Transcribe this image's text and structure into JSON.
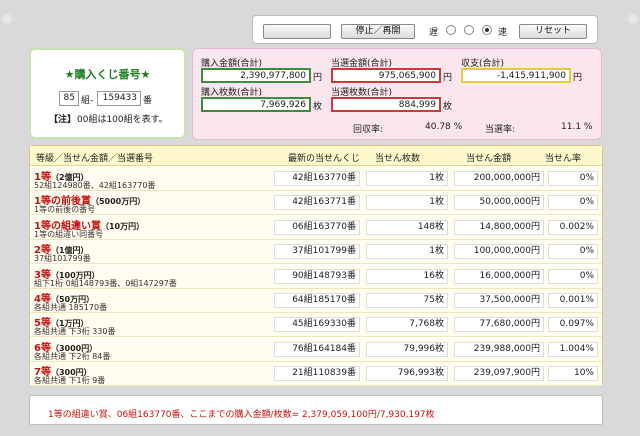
{
  "controls": {
    "blank_button": "",
    "stop_resume": "停止／再開",
    "speed_slow": "遅",
    "speed_fast": "速",
    "reset": "リセット"
  },
  "lot": {
    "title": "★購入くじ番号★",
    "group": "85",
    "group_suffix": "組-",
    "number": "159433",
    "number_suffix": "番",
    "note_tag": "【注】",
    "note_text": "00組は100組を表す。"
  },
  "summary": {
    "purchase_amount_label": "購入金額(合計)",
    "purchase_amount": "2,390,977,800",
    "purchase_count_label": "購入枚数(合計)",
    "purchase_count": "7,969,926",
    "win_amount_label": "当選金額(合計)",
    "win_amount": "975,065,900",
    "win_count_label": "当選枚数(合計)",
    "win_count": "884,999",
    "balance_label": "収支(合計)",
    "balance": "-1,415,911,900",
    "yen": "円",
    "mai": "枚",
    "recovery_label": "回収率:",
    "recovery": "40.78 %",
    "win_rate_label": "当選率:",
    "win_rate": "11.1 %"
  },
  "table": {
    "headers": [
      "等級／当せん金額／当選番号",
      "最新の当せんくじ",
      "当せん枚数",
      "当せん金額",
      "当せん率"
    ],
    "rows": [
      {
        "rank": "1等",
        "amount": "（2億円）",
        "sub": "52組124980番、42組163770番",
        "latest": "42組163770番",
        "count": "1枚",
        "money": "200,000,000円",
        "rate": "0%"
      },
      {
        "rank": "1等の前後賞",
        "amount": "（5000万円）",
        "sub": "1等の前後の番号",
        "latest": "42組163771番",
        "count": "1枚",
        "money": "50,000,000円",
        "rate": "0%"
      },
      {
        "rank": "1等の組違い賞",
        "amount": "（10万円）",
        "sub": "1等の組違い同番号",
        "latest": "06組163770番",
        "count": "148枚",
        "money": "14,800,000円",
        "rate": "0.002%"
      },
      {
        "rank": "2等",
        "amount": "（1億円）",
        "sub": "37組101799番",
        "latest": "37組101799番",
        "count": "1枚",
        "money": "100,000,000円",
        "rate": "0%"
      },
      {
        "rank": "3等",
        "amount": "（100万円）",
        "sub": "組下1桁 0組148793番、0組147297番",
        "latest": "90組148793番",
        "count": "16枚",
        "money": "16,000,000円",
        "rate": "0%"
      },
      {
        "rank": "4等",
        "amount": "（50万円）",
        "sub": "各組共通 185170番",
        "latest": "64組185170番",
        "count": "75枚",
        "money": "37,500,000円",
        "rate": "0.001%"
      },
      {
        "rank": "5等",
        "amount": "（1万円）",
        "sub": "各組共通 下3桁 330番",
        "latest": "45組169330番",
        "count": "7,768枚",
        "money": "77,680,000円",
        "rate": "0.097%"
      },
      {
        "rank": "6等",
        "amount": "（3000円）",
        "sub": "各組共通 下2桁 84番",
        "latest": "76組164184番",
        "count": "79,996枚",
        "money": "239,988,000円",
        "rate": "1.004%"
      },
      {
        "rank": "7等",
        "amount": "（300円）",
        "sub": "各組共通 下1桁 9番",
        "latest": "21組110839番",
        "count": "796,993枚",
        "money": "239,097,900円",
        "rate": "10%"
      }
    ]
  },
  "footer": {
    "text": "1等の組違い賞、06組163770番、ここまでの購入金額/枚数= 2,379,059,100円/7,930,197枚"
  }
}
